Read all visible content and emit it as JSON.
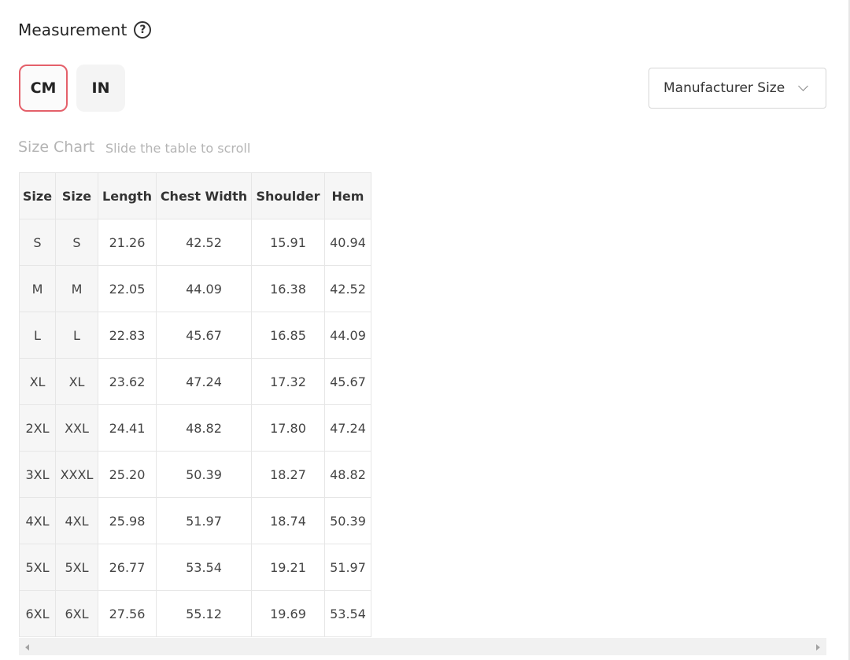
{
  "measurement": {
    "title": "Measurement",
    "help_glyph": "?"
  },
  "units": {
    "cm_label": "CM",
    "in_label": "IN",
    "selected": "CM",
    "selected_color": "#e4606a"
  },
  "size_select": {
    "value": "Manufacturer Size"
  },
  "size_chart": {
    "title": "Size Chart",
    "hint": "Slide the table to scroll",
    "columns": [
      "Size",
      "Size",
      "Length",
      "Chest Width",
      "Shoulder",
      "Hem"
    ],
    "rows": [
      [
        "S",
        "S",
        "21.26",
        "42.52",
        "15.91",
        "40.94"
      ],
      [
        "M",
        "M",
        "22.05",
        "44.09",
        "16.38",
        "42.52"
      ],
      [
        "L",
        "L",
        "22.83",
        "45.67",
        "16.85",
        "44.09"
      ],
      [
        "XL",
        "XL",
        "23.62",
        "47.24",
        "17.32",
        "45.67"
      ],
      [
        "2XL",
        "XXL",
        "24.41",
        "48.82",
        "17.80",
        "47.24"
      ],
      [
        "3XL",
        "XXXL",
        "25.20",
        "50.39",
        "18.27",
        "48.82"
      ],
      [
        "4XL",
        "4XL",
        "25.98",
        "51.97",
        "18.74",
        "50.39"
      ],
      [
        "5XL",
        "5XL",
        "26.77",
        "53.54",
        "19.21",
        "51.97"
      ],
      [
        "6XL",
        "6XL",
        "27.56",
        "55.12",
        "19.69",
        "53.54"
      ]
    ]
  }
}
